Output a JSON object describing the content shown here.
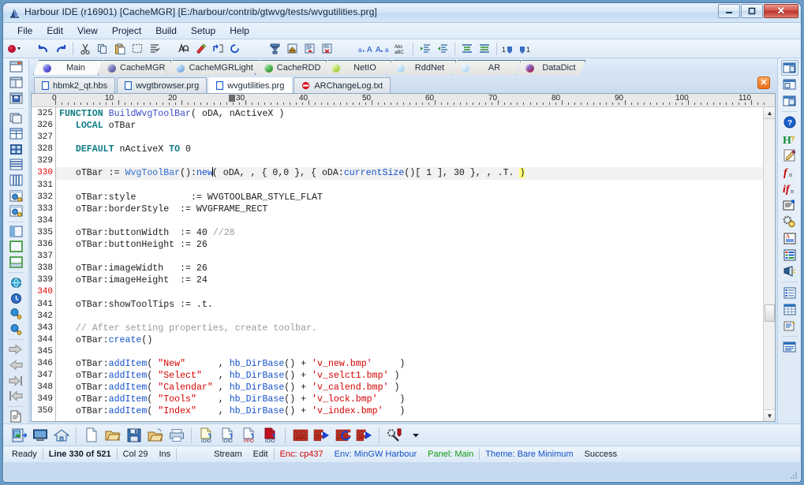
{
  "window": {
    "title": "Harbour IDE (r16901) [CacheMGR]  [E:/harbour/contrib/gtwvg/tests/wvgutilities.prg]",
    "icon": "app-icon",
    "buttons": {
      "minimize": "—",
      "maximize": "□",
      "close": "✕"
    }
  },
  "menubar": {
    "items": [
      {
        "label": "File"
      },
      {
        "label": "Edit"
      },
      {
        "label": "View"
      },
      {
        "label": "Project"
      },
      {
        "label": "Build"
      },
      {
        "label": "Setup"
      },
      {
        "label": "Help"
      }
    ]
  },
  "toolbar": {
    "groups": [
      {
        "items": [
          {
            "name": "record-dropdown-icon"
          }
        ]
      },
      {
        "items": [
          {
            "name": "undo-icon"
          },
          {
            "name": "redo-icon"
          }
        ]
      },
      {
        "items": [
          {
            "name": "cut-icon"
          },
          {
            "name": "copy-icon"
          },
          {
            "name": "paste-icon"
          },
          {
            "name": "select-all-icon"
          },
          {
            "name": "strip-icon"
          }
        ]
      },
      {
        "items": [
          {
            "name": "find-icon"
          },
          {
            "name": "replace-icon"
          },
          {
            "name": "goto-icon"
          },
          {
            "name": "refresh-icon"
          }
        ]
      },
      {
        "items": [
          {
            "name": "sort-icon"
          },
          {
            "name": "export-icon"
          },
          {
            "name": "print-preview-icon"
          },
          {
            "name": "delete-line-icon"
          }
        ]
      },
      {
        "items": [
          {
            "name": "lowercase-icon"
          },
          {
            "name": "uppercase-icon"
          },
          {
            "name": "spellcheck-icon"
          }
        ]
      },
      {
        "items": [
          {
            "name": "indent-icon"
          },
          {
            "name": "outdent-icon"
          }
        ]
      },
      {
        "items": [
          {
            "name": "block-indent-icon"
          },
          {
            "name": "block-outdent-icon"
          }
        ]
      },
      {
        "items": [
          {
            "name": "bookmark-set-icon"
          },
          {
            "name": "bookmark-goto-icon"
          }
        ]
      }
    ]
  },
  "left_sidebar": {
    "items": [
      {
        "name": "panel-view-icon"
      },
      {
        "name": "split-view-icon"
      },
      {
        "name": "save-panel-icon"
      },
      {
        "name": "copy-panel-icon"
      },
      {
        "name": "grid-icon"
      },
      {
        "name": "select-grid-icon"
      },
      {
        "name": "rows-icon"
      },
      {
        "name": "columns-icon"
      },
      {
        "name": "web-panel-icon"
      },
      {
        "name": "web-panel-alt-icon"
      },
      {
        "name": "pane-left-icon"
      },
      {
        "name": "pane-full-icon"
      },
      {
        "name": "pane-bottom-icon"
      },
      {
        "name": "globe-icon"
      },
      {
        "name": "clock-icon"
      },
      {
        "name": "zoom-in-icon"
      },
      {
        "name": "zoom-out-icon"
      },
      {
        "name": "arrow-right-icon"
      },
      {
        "name": "arrow-left-icon"
      },
      {
        "name": "arrow-end-icon"
      },
      {
        "name": "arrow-home-icon"
      },
      {
        "name": "document-icon"
      }
    ]
  },
  "right_sidebar": {
    "items": [
      {
        "name": "window-list-icon",
        "selected": true
      },
      {
        "name": "window-tile-icon",
        "selected": false
      },
      {
        "name": "window-cascade-icon",
        "selected": false
      },
      {
        "name": "help-icon",
        "selected": false
      },
      {
        "name": "harbour-help-icon",
        "selected": false
      },
      {
        "name": "edit-note-icon",
        "selected": false
      },
      {
        "name": "function-icon",
        "selected": false
      },
      {
        "name": "function-italic-icon",
        "selected": false
      },
      {
        "name": "properties-icon",
        "selected": false
      },
      {
        "name": "settings-gear-icon",
        "selected": false
      },
      {
        "name": "text-block-icon",
        "selected": false
      },
      {
        "name": "legend-icon",
        "selected": false
      },
      {
        "name": "flashlight-icon",
        "selected": false
      },
      {
        "name": "list-view-icon",
        "selected": false
      },
      {
        "name": "table-view-icon",
        "selected": false
      },
      {
        "name": "report-icon",
        "selected": false
      },
      {
        "name": "output-pane-icon",
        "selected": false
      }
    ]
  },
  "panel_tabs": {
    "active_index": 0,
    "items": [
      {
        "label": "Main",
        "color": "#3b3bc8",
        "active": true
      },
      {
        "label": "CacheMGR",
        "color": "#5a5aa8",
        "active": false
      },
      {
        "label": "CacheMGRLight",
        "color": "#6aa8e8",
        "active": false
      },
      {
        "label": "CacheRDD",
        "color": "#2fa02f",
        "active": false
      },
      {
        "label": "NetIO",
        "color": "#9ccc2a",
        "active": false
      },
      {
        "label": "RddNet",
        "color": "#9fd0f2",
        "active": false
      },
      {
        "label": "AR",
        "color": "#a8d4f0",
        "active": false
      },
      {
        "label": "DataDict",
        "color": "#c01030",
        "active": false
      }
    ]
  },
  "file_tabs": {
    "close_label": "✕",
    "items": [
      {
        "label": "hbmk2_qt.hbs",
        "icon": "file-blue-icon",
        "active": false
      },
      {
        "label": "wvgtbrowser.prg",
        "icon": "file-blue-icon",
        "active": false
      },
      {
        "label": "wvgutilities.prg",
        "icon": "file-blue-icon",
        "active": true
      },
      {
        "label": "ARChangeLog.txt",
        "icon": "file-block-icon",
        "active": false
      }
    ]
  },
  "ruler": {
    "numbers": [
      "0",
      "10",
      "20",
      "30",
      "40",
      "50",
      "60",
      "70",
      "80",
      "90",
      "100",
      "110"
    ],
    "marker_column": "30"
  },
  "editor": {
    "current_line": 330,
    "first_line": 325,
    "lines": [
      {
        "n": "325",
        "html": "<span class=\"kw\">FUNCTION</span> <span class=\"fn\">BuildWvgToolBar</span>( oDA, nActiveX )"
      },
      {
        "n": "326",
        "html": "   <span class=\"kw\">LOCAL</span> oTBar"
      },
      {
        "n": "327",
        "html": ""
      },
      {
        "n": "328",
        "html": "   <span class=\"kw\">DEFAULT</span> nActiveX <span class=\"kw\">TO</span> 0"
      },
      {
        "n": "329",
        "html": ""
      },
      {
        "n": "330",
        "html": "   oTBar := <span class=\"cls\">WvgToolBar</span>():<span class=\"mth\">new</span><span class=\"caret\"></span>( oDA, , { 0,0 }, { oDA:<span class=\"mth\">currentSize</span>()[ 1 ], 30 }, , .T. <span class=\"hly\">)</span>"
      },
      {
        "n": "331",
        "html": ""
      },
      {
        "n": "332",
        "html": "   oTBar:style          := WVGTOOLBAR_STYLE_FLAT"
      },
      {
        "n": "333",
        "html": "   oTBar:borderStyle  := WVGFRAME_RECT"
      },
      {
        "n": "334",
        "html": ""
      },
      {
        "n": "335",
        "html": "   oTBar:buttonWidth  := 40 <span class=\"com\">//28</span>"
      },
      {
        "n": "336",
        "html": "   oTBar:buttonHeight := 26"
      },
      {
        "n": "337",
        "html": ""
      },
      {
        "n": "338",
        "html": "   oTBar:imageWidth   := 26"
      },
      {
        "n": "339",
        "html": "   oTBar:imageHeight  := 24"
      },
      {
        "n": "340",
        "html": ""
      },
      {
        "n": "341",
        "html": "   oTBar:showToolTips := .t."
      },
      {
        "n": "342",
        "html": ""
      },
      {
        "n": "343",
        "html": "   <span class=\"com\">// After setting properties, create toolbar.</span>"
      },
      {
        "n": "344",
        "html": "   oTBar:<span class=\"mth\">create</span>()"
      },
      {
        "n": "345",
        "html": ""
      },
      {
        "n": "346",
        "html": "   oTBar:<span class=\"mth\">addItem</span>( <span class=\"str\">\"New\"</span>      , <span class=\"mth\">hb_DirBase</span>() + <span class=\"str\">'v_new.bmp'</span>     )"
      },
      {
        "n": "347",
        "html": "   oTBar:<span class=\"mth\">addItem</span>( <span class=\"str\">\"Select\"</span>   , <span class=\"mth\">hb_DirBase</span>() + <span class=\"str\">'v_selct1.bmp'</span> )"
      },
      {
        "n": "348",
        "html": "   oTBar:<span class=\"mth\">addItem</span>( <span class=\"str\">\"Calendar\"</span> , <span class=\"mth\">hb_DirBase</span>() + <span class=\"str\">'v_calend.bmp'</span> )"
      },
      {
        "n": "349",
        "html": "   oTBar:<span class=\"mth\">addItem</span>( <span class=\"str\">\"Tools\"</span>    , <span class=\"mth\">hb_DirBase</span>() + <span class=\"str\">'v_lock.bmp'</span>    )"
      },
      {
        "n": "350",
        "html": "   oTBar:<span class=\"mth\">addItem</span>( <span class=\"str\">\"Index\"</span>    , <span class=\"mth\">hb_DirBase</span>() + <span class=\"str\">'v_index.bmp'</span>   )"
      }
    ]
  },
  "bottom_toolbar": {
    "items": [
      {
        "name": "exit-icon"
      },
      {
        "name": "screen-icon"
      },
      {
        "name": "home-icon"
      },
      {
        "name": "new-file-icon"
      },
      {
        "name": "open-file-icon"
      },
      {
        "name": "save-file-icon"
      },
      {
        "name": "open-project-icon"
      },
      {
        "name": "print-icon"
      },
      {
        "name": "compile-icon"
      },
      {
        "name": "compile-alt-icon"
      },
      {
        "name": "ppo-icon"
      },
      {
        "name": "compile-error-icon"
      },
      {
        "name": "build-icon"
      },
      {
        "name": "build-run-icon"
      },
      {
        "name": "rebuild-icon"
      },
      {
        "name": "rebuild-run-icon"
      },
      {
        "name": "tools-icon"
      },
      {
        "name": "dropdown-arrow-icon"
      }
    ]
  },
  "statusbar": {
    "ready": "Ready",
    "line": "Line 330 of 521",
    "col": "Col 29",
    "mode": "Ins",
    "stream": "Stream",
    "edit": "Edit",
    "encoding": "Enc: cp437",
    "environment": "Env: MinGW Harbour",
    "panel": "Panel: Main",
    "theme": "Theme: Bare Minimum",
    "result": "Success"
  },
  "colors": {
    "accent": "#3b4cc8",
    "encoding": "#d40000",
    "environment": "#1450c8",
    "panel": "#0e9a0e",
    "theme": "#1450c8",
    "highlight": "#ffff7a"
  }
}
